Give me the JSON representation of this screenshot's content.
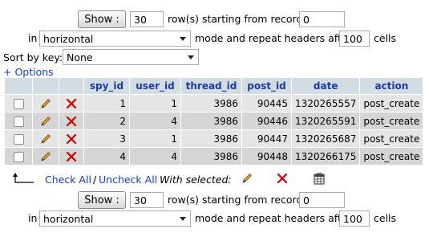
{
  "nav_top": {
    "show_label": "Show :",
    "rows_value": "30",
    "rows_text": "row(s) starting from record #",
    "start_value": "0",
    "in_label": "in",
    "mode_value": "horizontal",
    "mode_text": "mode and repeat headers after",
    "repeat_value": "100",
    "cells_text": "cells"
  },
  "sort": {
    "label": "Sort by key:",
    "value": "None"
  },
  "options_link": "+ Options",
  "table": {
    "columns": [
      "spy_id",
      "user_id",
      "thread_id",
      "post_id",
      "date",
      "action"
    ],
    "rows": [
      [
        "1",
        "1",
        "3986",
        "90445",
        "1320265557",
        "post_create"
      ],
      [
        "2",
        "4",
        "3986",
        "90446",
        "1320265591",
        "post_create"
      ],
      [
        "3",
        "1",
        "3986",
        "90447",
        "1320265687",
        "post_create"
      ],
      [
        "4",
        "4",
        "3986",
        "90448",
        "1320266175",
        "post_create"
      ]
    ]
  },
  "bulk": {
    "check_all": "Check All",
    "separator": "/",
    "uncheck_all": "Uncheck All",
    "with_selected": "With selected:"
  },
  "nav_bottom": {
    "show_label": "Show :",
    "rows_value": "30",
    "rows_text": "row(s) starting from record #",
    "start_value": "0",
    "in_label": "in",
    "mode_value": "horizontal",
    "mode_text": "mode and repeat headers after",
    "repeat_value": "100",
    "cells_text": "cells"
  },
  "colors": {
    "header_bg": "#d3dce3",
    "header_text": "#1c3aa9",
    "row_odd": "#e5e5e5",
    "row_even": "#d5d5d5",
    "link": "#1a3cc8",
    "delete_red": "#d40000"
  },
  "icons": {
    "edit": "pencil-icon",
    "delete": "red-x-icon",
    "export": "export-table-icon",
    "arrow": "corner-arrow-icon"
  }
}
